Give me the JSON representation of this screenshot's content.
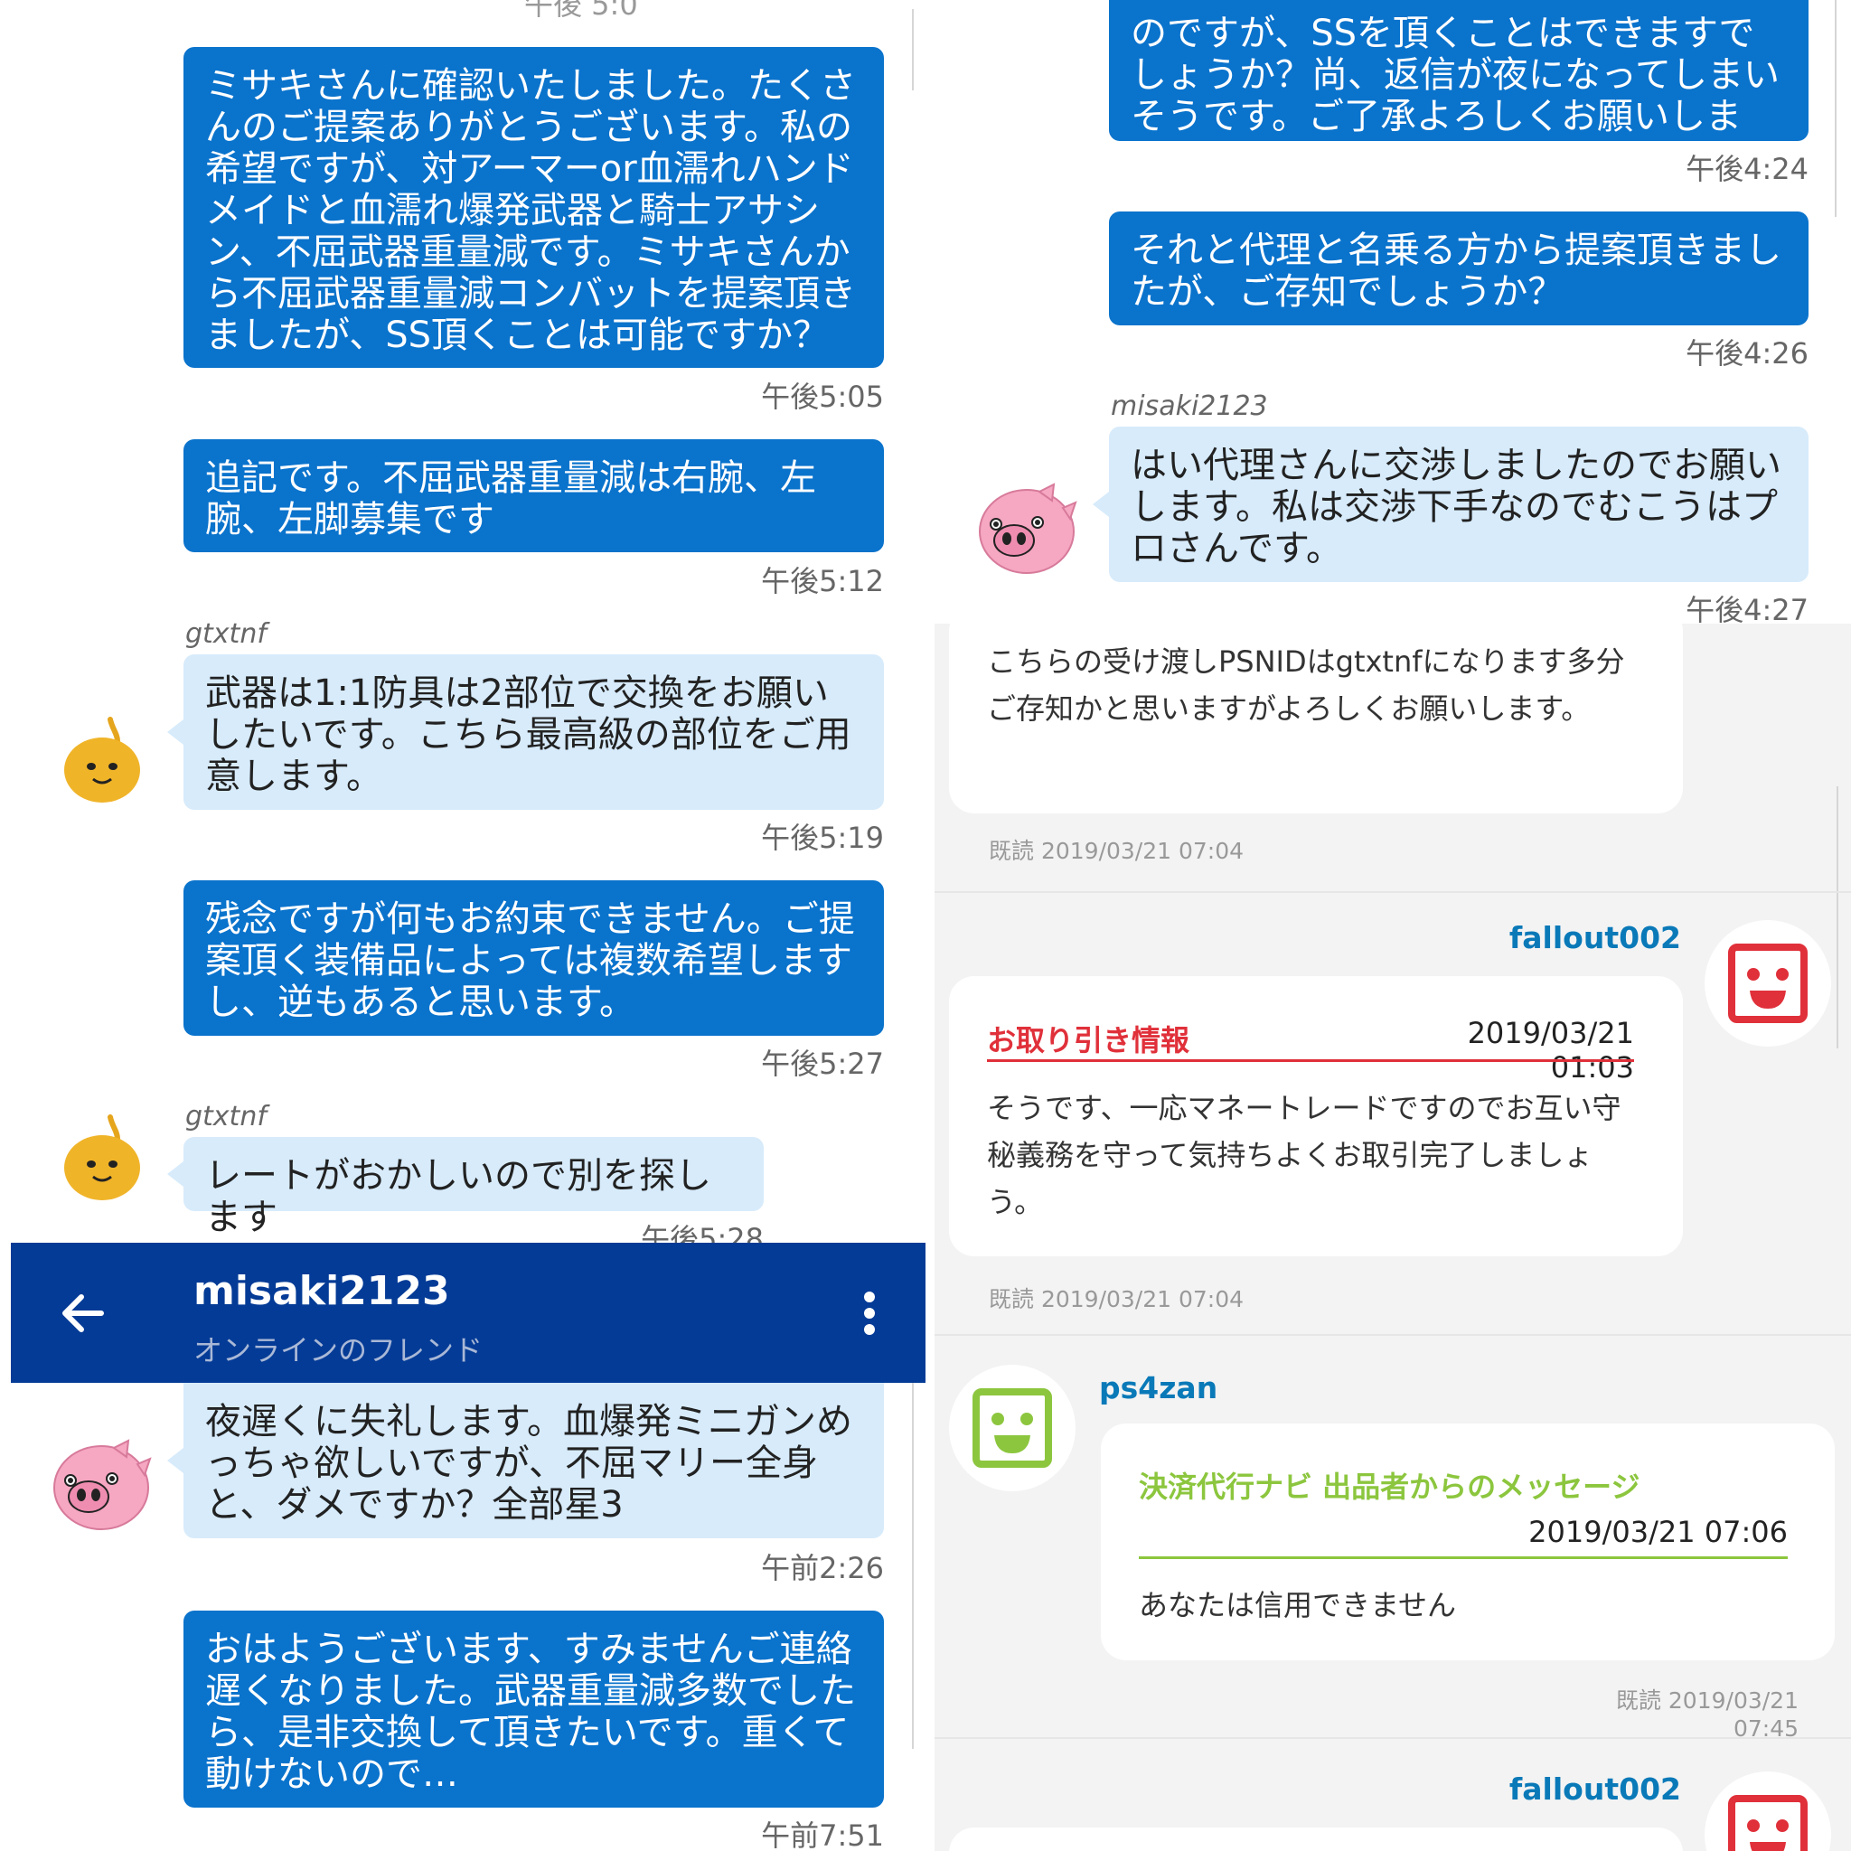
{
  "topleft": {
    "cut_timestamp": "午後 5:0",
    "messages": [
      {
        "text": "ミサキさんに確認いたしました。たくさんのご提案ありがとうございます。私の希望ですが、対アーマーor血濡れハンドメイドと血濡れ爆発武器と騎士アサシン、不屈武器重量減です。ミサキさんから不屈武器重量減コンバットを提案頂きましたが、SS頂くことは可能ですか？",
        "time": "午後5:05"
      },
      {
        "text": "追記です。不屈武器重量減は右腕、左腕、左脚募集です",
        "time": "午後5:12"
      },
      {
        "sender": "gtxtnf",
        "text": "武器は1:1防具は2部位で交換をお願いしたいです。こちら最高級の部位をご用意します。",
        "time": "午後5:19"
      },
      {
        "text": "残念ですが何もお約束できません。ご提案頂く装備品によっては複数希望しますし、逆もあると思います。",
        "time": "午後5:27"
      },
      {
        "sender": "gtxtnf",
        "text": "レートがおかしいので別を探します",
        "time": "午後5:28"
      }
    ]
  },
  "header": {
    "title": "misaki2123",
    "subtitle": "オンラインのフレンド"
  },
  "bottomleft": {
    "messages": [
      {
        "text": "夜遅くに失礼します。血爆発ミニガンめっちゃ欲しいですが、不屈マリー全身と、ダメですか？全部星3",
        "time": "午前2:26"
      },
      {
        "text": "おはようございます、すみませんご連絡遅くなりました。武器重量減多数でしたら、是非交換して頂きたいです。重くて動けないので…",
        "time": "午前7:51"
      }
    ]
  },
  "topright": {
    "messages": [
      {
        "text": "のですが、SSを頂くことはできますでしょうか？尚、返信が夜になってしまいそうです。ご了承よろしくお願いします。",
        "time": "午後4:24"
      },
      {
        "text": "それと代理と名乗る方から提案頂きましたが、ご存知でしょうか？",
        "time": "午後4:26"
      },
      {
        "sender": "misaki2123",
        "text": "はい代理さんに交渉しましたのでお願いします。私は交渉下手なのでむこうはプロさんです。",
        "time": "午後4:27"
      }
    ]
  },
  "bottomright": {
    "first_card": {
      "text": "こちらの受け渡しPSNIDはgtxtnfになります多分ご存知かと思いますがよろしくお願いします。",
      "read": "既読 2019/03/21 07:04"
    },
    "second": {
      "user": "fallout002",
      "title": "お取り引き情報",
      "date": "2019/03/21 01:03",
      "text": "そうです、一応マネートレードですのでお互い守秘義務を守って気持ちよくお取引完了しましょう。",
      "read": "既読 2019/03/21 07:04"
    },
    "third": {
      "user": "ps4zan",
      "title": "決済代行ナビ 出品者からのメッセージ",
      "date": "2019/03/21 07:06",
      "text": "あなたは信用できません",
      "read": "既読 2019/03/21 07:45"
    },
    "fourth": {
      "user": "fallout002"
    }
  },
  "colors": {
    "outgoing": "#0a73cc",
    "incoming": "#d7ebfb",
    "header": "#043b96",
    "accent_red": "#e0303a",
    "accent_green": "#8cc63e",
    "username": "#0a79b8"
  }
}
